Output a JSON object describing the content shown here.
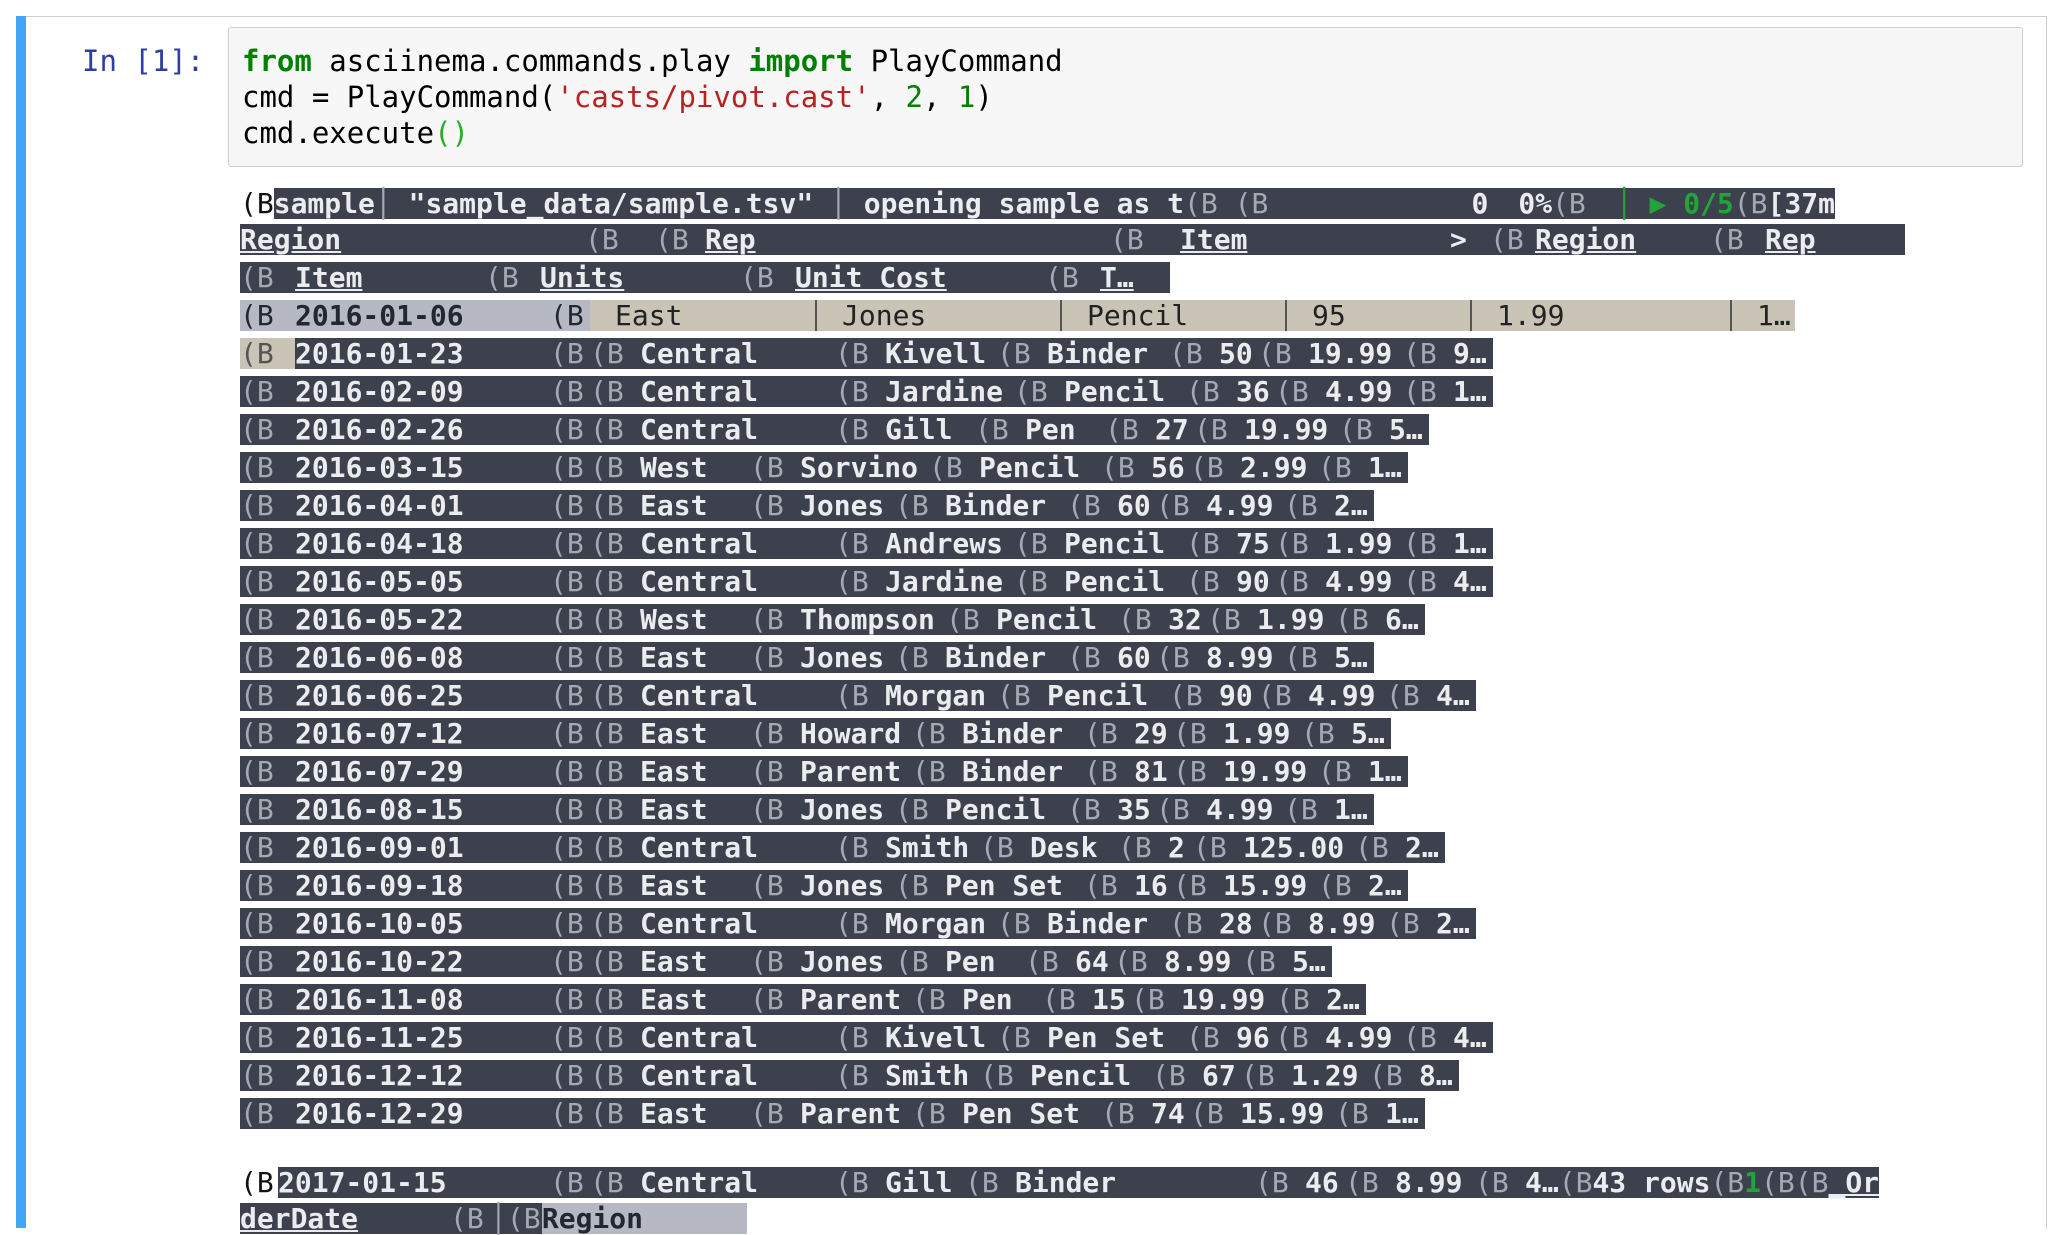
{
  "prompt": "In [1]:",
  "code": {
    "line1": {
      "kw1": "from",
      "mod": " asciinema.commands.play ",
      "kw2": "import",
      "name": " PlayCommand"
    },
    "line2": {
      "pre": "cmd = PlayCommand(",
      "str": "'casts/pivot.cast'",
      "mid": ", ",
      "n1": "2",
      "comma": ", ",
      "n2": "1",
      "post": ")"
    },
    "line3": {
      "pre": "cmd.execute",
      "paren": "()"
    }
  },
  "terminal": {
    "status": {
      "esc": "(B",
      "title": "sample",
      "sep1": "│ ",
      "file": "\"sample_data/sample.tsv\"",
      "sep2": " │ ",
      "message": "opening sample as t",
      "esc2": "(B (B",
      "count": "0",
      "pct": "0%",
      "esc3": "(B",
      "arrow": "│ ▶ ",
      "progress": "0/5",
      "esc4": "(B",
      "tail": "[37m"
    },
    "header1": {
      "col1": "Region",
      "esc": "(B",
      "col2": "Rep",
      "col3": "Item",
      "arrow": ">",
      "col4": "Region",
      "col5": "Rep"
    },
    "header2": {
      "col1": "Item",
      "col2": "Units",
      "col3": "Unit Cost",
      "col4": "T…"
    },
    "selected_row": {
      "date": "2016-01-06",
      "region": "East",
      "rep": "Jones",
      "item": "Pencil",
      "units": "95",
      "cost": "1.99",
      "total": "1…"
    },
    "rows": [
      {
        "date": "2016-01-23",
        "region": "Central",
        "rep": "Kivell",
        "item": "Binder",
        "units": "50",
        "cost": "19.99",
        "total": "9…"
      },
      {
        "date": "2016-02-09",
        "region": "Central",
        "rep": "Jardine",
        "item": "Pencil",
        "units": "36",
        "cost": "4.99",
        "total": "1…"
      },
      {
        "date": "2016-02-26",
        "region": "Central",
        "rep": "Gill",
        "item": "Pen",
        "units": "27",
        "cost": "19.99",
        "total": "5…"
      },
      {
        "date": "2016-03-15",
        "region": "West",
        "rep": "Sorvino",
        "item": "Pencil",
        "units": "56",
        "cost": "2.99",
        "total": "1…"
      },
      {
        "date": "2016-04-01",
        "region": "East",
        "rep": "Jones",
        "item": "Binder",
        "units": "60",
        "cost": "4.99",
        "total": "2…"
      },
      {
        "date": "2016-04-18",
        "region": "Central",
        "rep": "Andrews",
        "item": "Pencil",
        "units": "75",
        "cost": "1.99",
        "total": "1…"
      },
      {
        "date": "2016-05-05",
        "region": "Central",
        "rep": "Jardine",
        "item": "Pencil",
        "units": "90",
        "cost": "4.99",
        "total": "4…"
      },
      {
        "date": "2016-05-22",
        "region": "West",
        "rep": "Thompson",
        "item": "Pencil",
        "units": "32",
        "cost": "1.99",
        "total": "6…"
      },
      {
        "date": "2016-06-08",
        "region": "East",
        "rep": "Jones",
        "item": "Binder",
        "units": "60",
        "cost": "8.99",
        "total": "5…"
      },
      {
        "date": "2016-06-25",
        "region": "Central",
        "rep": "Morgan",
        "item": "Pencil",
        "units": "90",
        "cost": "4.99",
        "total": "4…"
      },
      {
        "date": "2016-07-12",
        "region": "East",
        "rep": "Howard",
        "item": "Binder",
        "units": "29",
        "cost": "1.99",
        "total": "5…"
      },
      {
        "date": "2016-07-29",
        "region": "East",
        "rep": "Parent",
        "item": "Binder",
        "units": "81",
        "cost": "19.99",
        "total": "1…"
      },
      {
        "date": "2016-08-15",
        "region": "East",
        "rep": "Jones",
        "item": "Pencil",
        "units": "35",
        "cost": "4.99",
        "total": "1…"
      },
      {
        "date": "2016-09-01",
        "region": "Central",
        "rep": "Smith",
        "item": "Desk",
        "units": "2",
        "cost": "125.00",
        "total": "2…"
      },
      {
        "date": "2016-09-18",
        "region": "East",
        "rep": "Jones",
        "item": "Pen Set",
        "units": "16",
        "cost": "15.99",
        "total": "2…"
      },
      {
        "date": "2016-10-05",
        "region": "Central",
        "rep": "Morgan",
        "item": "Binder",
        "units": "28",
        "cost": "8.99",
        "total": "2…"
      },
      {
        "date": "2016-10-22",
        "region": "East",
        "rep": "Jones",
        "item": "Pen",
        "units": "64",
        "cost": "8.99",
        "total": "5…"
      },
      {
        "date": "2016-11-08",
        "region": "East",
        "rep": "Parent",
        "item": "Pen",
        "units": "15",
        "cost": "19.99",
        "total": "2…"
      },
      {
        "date": "2016-11-25",
        "region": "Central",
        "rep": "Kivell",
        "item": "Pen Set",
        "units": "96",
        "cost": "4.99",
        "total": "4…"
      },
      {
        "date": "2016-12-12",
        "region": "Central",
        "rep": "Smith",
        "item": "Pencil",
        "units": "67",
        "cost": "1.29",
        "total": "8…"
      },
      {
        "date": "2016-12-29",
        "region": "East",
        "rep": "Parent",
        "item": "Pen Set",
        "units": "74",
        "cost": "15.99",
        "total": "1…"
      }
    ],
    "esc_marker": "(B",
    "footer_row": {
      "date": "2017-01-15",
      "region": "Central",
      "rep": "Gill",
      "item": "Binder",
      "units": "46",
      "cost": "8.99",
      "total": "4…",
      "esc": "(B",
      "rows_text": "43 rows",
      "esc2": "(B",
      "one": "1",
      "esc3": "(B(B",
      "tail": "_Or"
    },
    "footer2": {
      "text1": "derDate",
      "esc": "(B",
      "sep": "│",
      "esc2": "(B",
      "region": "Region"
    }
  }
}
